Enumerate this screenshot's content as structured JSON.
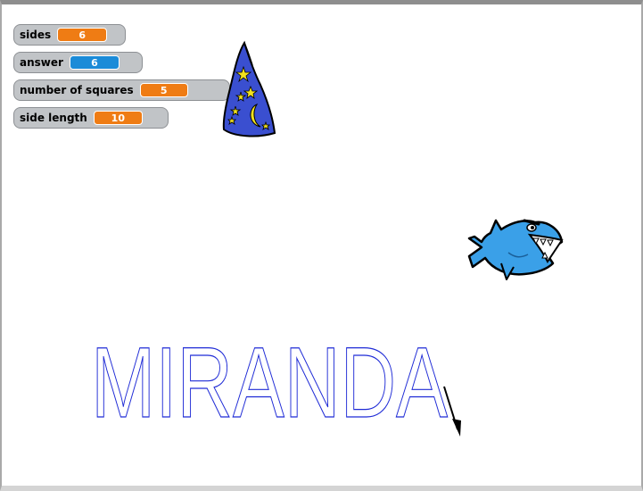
{
  "monitors": [
    {
      "label": "sides",
      "value": "6",
      "color": "#ef7c14"
    },
    {
      "label": "answer",
      "value": "6",
      "color": "#1b8bd8"
    },
    {
      "label": "number of squares",
      "value": "5",
      "color": "#ef7c14"
    },
    {
      "label": "side length",
      "value": "10",
      "color": "#ef7c14"
    }
  ],
  "stage": {
    "drawn_text": "MIRANDA",
    "pen_color": "#1f2bd6",
    "sprites": [
      "wizard-hat",
      "shark",
      "arrow-cursor"
    ]
  }
}
